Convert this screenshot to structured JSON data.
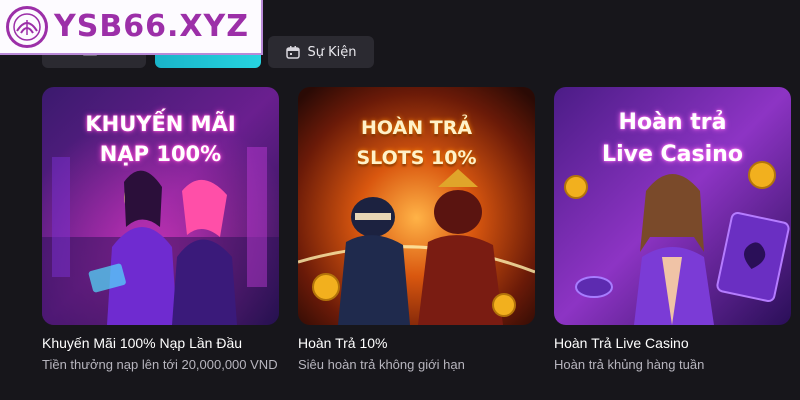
{
  "brand": {
    "name": "YSB66.XYZ"
  },
  "tabs": [
    {
      "label": "",
      "icon": "list-icon"
    },
    {
      "label": "",
      "icon": "grid-icon"
    },
    {
      "label": "Sự Kiện",
      "icon": "calendar-icon"
    }
  ],
  "cards": [
    {
      "banner_line1": "KHUYẾN MÃI",
      "banner_line2": "NẠP 100%",
      "title": "Khuyến Mãi 100% Nạp Lần Đầu",
      "description": "Tiền thưởng nạp lên tới 20,000,000 VND"
    },
    {
      "banner_line1": "HOÀN TRẢ",
      "banner_line2": "SLOTS 10%",
      "title": "Hoàn Trả 10%",
      "description": "Siêu hoàn trả không giới hạn"
    },
    {
      "banner_line1": "Hoàn trả",
      "banner_line2": "Live Casino",
      "title": "Hoàn Trả Live Casino",
      "description": "Hoàn trả khủng hàng tuần"
    }
  ],
  "colors": {
    "background": "#17161b",
    "tab_active": "#22c7d8",
    "brand": "#9c2fa8"
  }
}
